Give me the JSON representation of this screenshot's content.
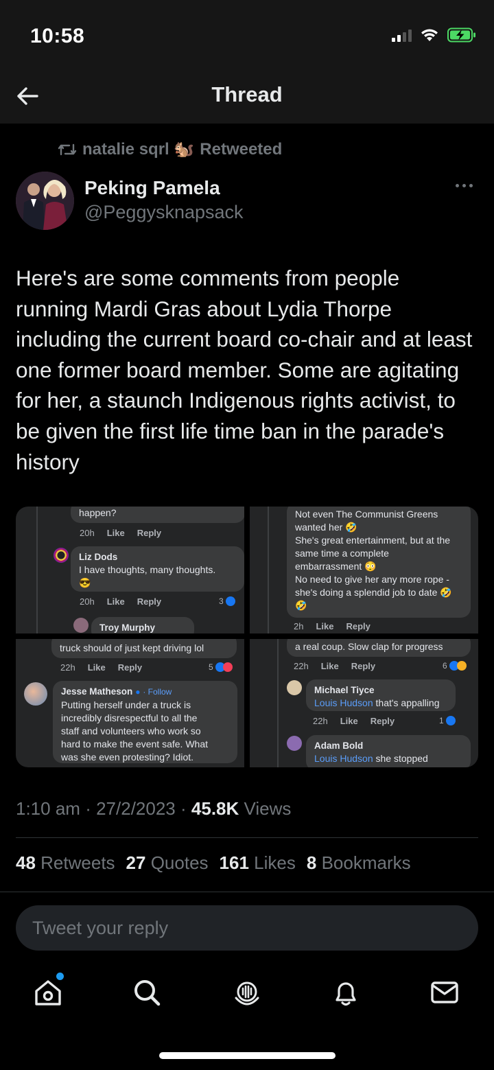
{
  "status_bar": {
    "time": "10:58"
  },
  "nav": {
    "title": "Thread"
  },
  "retweet": {
    "user": "natalie sqrl 🐿️",
    "label": "Retweeted"
  },
  "author": {
    "name": "Peking Pamela",
    "handle": "@Peggysknapsack"
  },
  "tweet": {
    "text": "Here's are some comments from people running Mardi Gras about Lydia Thorpe including the current board co-chair and at least one former board member. Some are agitating for her, a staunch Indigenous rights activist, to be given the first life time ban in the parade's history",
    "time": "1:10 am",
    "sep1": "·",
    "date": "27/2/2023",
    "sep2": "·",
    "views_count": "45.8K",
    "views_label": "Views"
  },
  "stats": {
    "retweets": {
      "count": "48",
      "label": "Retweets"
    },
    "quotes": {
      "count": "27",
      "label": "Quotes"
    },
    "likes": {
      "count": "161",
      "label": "Likes"
    },
    "bookmarks": {
      "count": "8",
      "label": "Bookmarks"
    }
  },
  "media": {
    "img1": {
      "top_text": "happen?",
      "meta1": {
        "time": "20h",
        "like": "Like",
        "reply": "Reply"
      },
      "comment_name": "Liz Dods",
      "comment_text": "I have thoughts, many thoughts.",
      "comment_emoji": "😎",
      "meta2": {
        "time": "20h",
        "like": "Like",
        "reply": "Reply",
        "count": "3"
      },
      "next_name": "Troy Murphy"
    },
    "img2": {
      "line1": "Not even The Communist Greens",
      "line2": "wanted her 🤣",
      "line3": "She's great entertainment, but at the",
      "line4": "same time a complete",
      "line5": "embarrassment 😳",
      "line6": "No need to give her any more rope -",
      "line7": "she's doing a splendid job to date 🤣",
      "line8": "🤣",
      "meta": {
        "time": "2h",
        "like": "Like",
        "reply": "Reply"
      }
    },
    "img3": {
      "top_text": "truck should of just kept driving lol",
      "meta1": {
        "time": "22h",
        "like": "Like",
        "reply": "Reply",
        "count": "5"
      },
      "comment_name": "Jesse Matheson",
      "follow": "· Follow",
      "line1": "Putting herself under a truck is",
      "line2": "incredibly disrespectful to all the",
      "line3": "staff and volunteers who work so",
      "line4": "hard to make the event safe. What",
      "line5": "was she even protesting? Idiot."
    },
    "img4": {
      "top_text": "a real coup. Slow clap for progress",
      "meta1": {
        "time": "22h",
        "like": "Like",
        "reply": "Reply",
        "count": "6"
      },
      "c1_name": "Michael Tiyce",
      "c1_link": "Louis Hudson",
      "c1_text": " that's appalling",
      "meta2": {
        "time": "22h",
        "like": "Like",
        "reply": "Reply",
        "count": "1"
      },
      "c2_name": "Adam Bold",
      "c2_link": "Louis Hudson",
      "c2_text": " she stopped"
    }
  },
  "reply": {
    "placeholder": "Tweet your reply"
  },
  "tabs": [
    "home-icon",
    "search-icon",
    "spaces-icon",
    "notifications-icon",
    "messages-icon"
  ],
  "colors": {
    "accent": "#1d9bf0",
    "background": "#000000",
    "secondary_text": "#71767b"
  }
}
